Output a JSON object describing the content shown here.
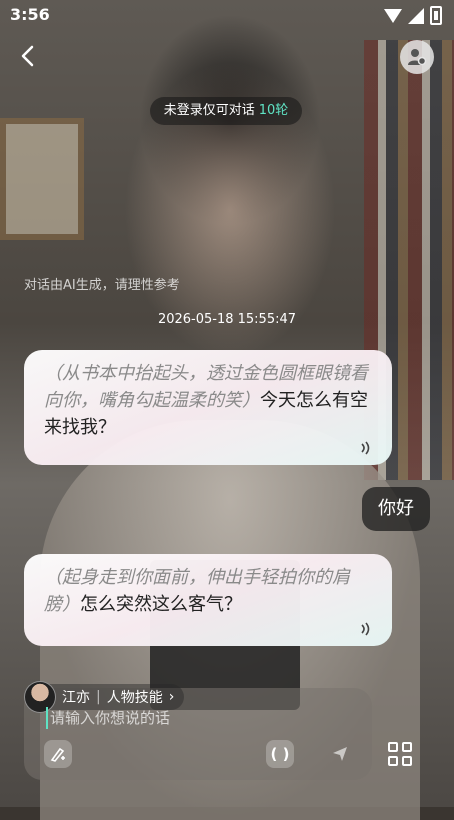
{
  "status": {
    "time": "3:56"
  },
  "header": {
    "login_notice": "未登录仅可对话",
    "rounds": "10轮"
  },
  "disclaimer": "对话由AI生成，请理性参考",
  "timestamp": "2026-05-18 15:55:47",
  "messages": [
    {
      "role": "ai",
      "action": "（从书本中抬起头，透过金色圆框眼镜看向你，嘴角勾起温柔的笑）",
      "text": "今天怎么有空来找我？"
    },
    {
      "role": "user",
      "text": "你好"
    },
    {
      "role": "ai",
      "action": "（起身走到你面前，伸出手轻拍你的肩膀）",
      "text": "怎么突然这么客气？"
    }
  ],
  "composer": {
    "character_name": "江亦",
    "skill_label": "人物技能",
    "placeholder": "请输入你想说的话",
    "paren_label": "( )"
  },
  "icons": {
    "back": "chevron-left-icon",
    "user": "user-settings-icon",
    "speaker": "speaker-icon",
    "brush": "pen-sparkle-icon",
    "send": "send-icon",
    "grid": "grid-icon"
  },
  "colors": {
    "accent": "#5fe3c4"
  }
}
